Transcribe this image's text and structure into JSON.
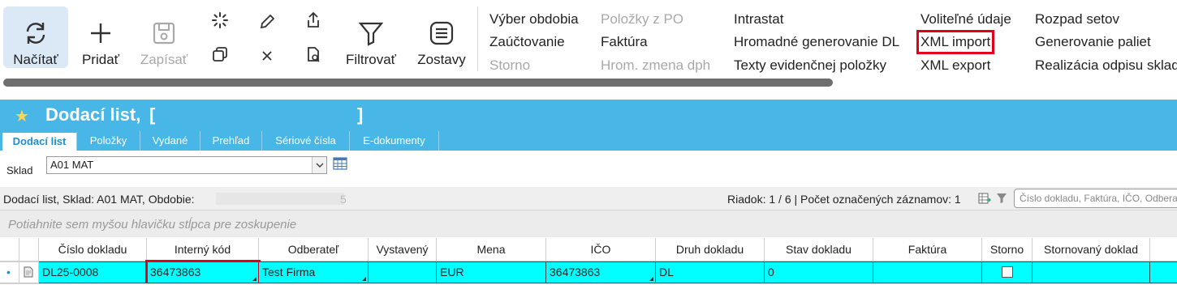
{
  "ribbon": {
    "refresh_label": "Načítať",
    "add_label": "Pridať",
    "save_label": "Zapísať",
    "filter_label": "Filtrovať",
    "reports_label": "Zostavy",
    "menu_col1": [
      "Výber obdobia",
      "Zaúčtovanie",
      "Storno"
    ],
    "menu_col2": [
      "Položky z PO",
      "Faktúra",
      "Hrom. zmena dph"
    ],
    "menu_col3": [
      "Intrastat",
      "Hromadné generovanie DL",
      "Texty evidenčnej položky"
    ],
    "menu_col4": [
      "Voliteľné údaje",
      "XML import",
      "XML export"
    ],
    "menu_col5": [
      "Rozpad setov",
      "Generovanie paliet",
      "Realizácia odpisu sklad"
    ]
  },
  "document": {
    "title": "Dodací list,",
    "bracket_open": "[",
    "bracket_close": "]",
    "tabs": [
      "Dodací list",
      "Položky",
      "Vydané",
      "Prehľad",
      "Sériové čísla",
      "E-dokumenty"
    ]
  },
  "filter": {
    "sklad_label": "Sklad",
    "sklad_value": "A01 MAT"
  },
  "grid_info": {
    "left_text": "Dodací list, Sklad: A01 MAT, Obdobie:",
    "left_tail": "5",
    "right_text": "Riadok: 1 / 6 | Počet označených záznamov: 1",
    "search_placeholder": "Číslo dokladu, Faktúra, IČO, Odberateľ"
  },
  "group_hint": "Potiahnite sem myšou hlavičku stĺpca pre zoskupenie",
  "table": {
    "columns": [
      "Číslo dokladu",
      "Interný kód",
      "Odberateľ",
      "Vystavený",
      "Mena",
      "IČO",
      "Druh dokladu",
      "Stav dokladu",
      "Faktúra",
      "Storno",
      "Stornovaný doklad"
    ],
    "rows": [
      {
        "cislo": "DL25-0008",
        "interny_kod": "36473863",
        "odberatel": "Test Firma",
        "vystaveny": "",
        "mena": "EUR",
        "ico": "36473863",
        "druh": "DL",
        "stav": "0",
        "faktura": "",
        "stornovany": ""
      }
    ]
  },
  "colors": {
    "accent": "#48b6e6",
    "selected_row": "#00ffff",
    "highlight_box": "#e0001b"
  }
}
